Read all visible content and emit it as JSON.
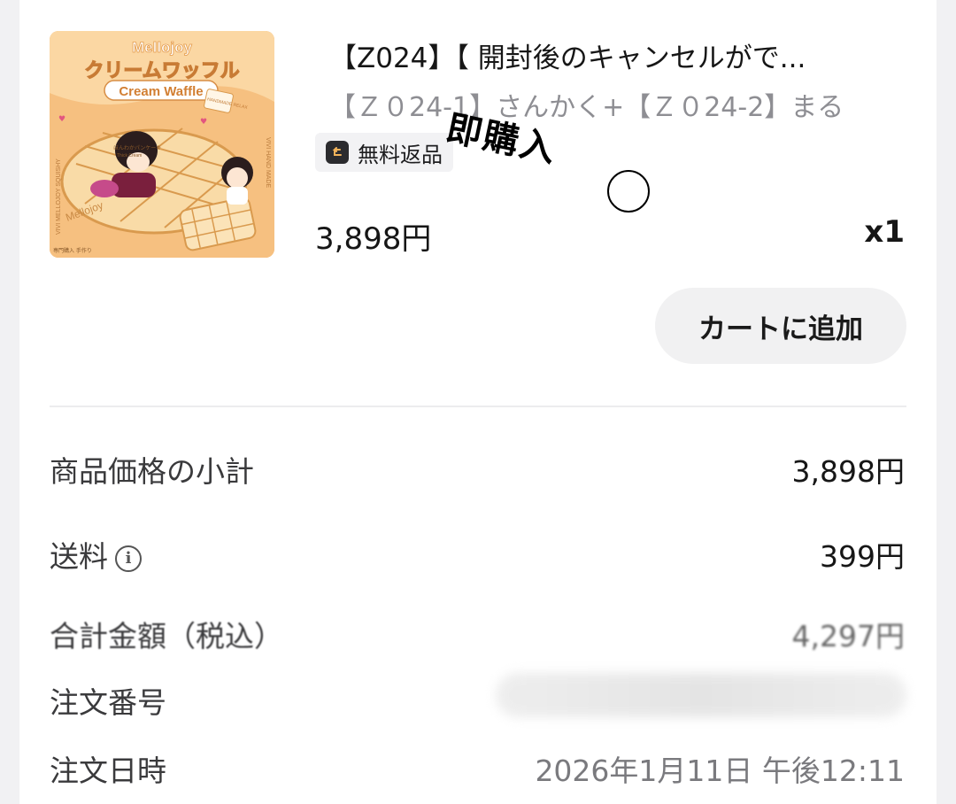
{
  "product": {
    "title": "【Z024】【 開封後のキャンセルがで...",
    "variant": "【Ｚ０24-1】さんかく+【Ｚ０24-2】まる",
    "badge": "無料返品",
    "price": "3,898円",
    "quantity": "x1",
    "add_to_cart": "カートに追加",
    "thumbnail": {
      "brand": "Mellojoy",
      "headline": "クリームワッフル",
      "subtitle": "Cream Waffle",
      "side_text_left": "VIVI MELLOJOY SQUISHY",
      "side_text_right": "VIVI HAND MADE",
      "mini_label": "ほんわかパンケーキ",
      "mini_label2": "Thick Cream",
      "card_label": "HANDMADE RELAX",
      "footer": "専門購入 手作り",
      "heart": "♥"
    }
  },
  "annotation": {
    "handwritten": "即購入",
    "circle": "○"
  },
  "summary": {
    "rows": [
      {
        "label": "商品価格の小計",
        "value": "3,898円"
      },
      {
        "label": "送料",
        "value": "399円"
      },
      {
        "label": "合計金額（税込）",
        "value": "4,297円"
      },
      {
        "label": "注文番号",
        "value": ""
      },
      {
        "label": "注文日時",
        "value": "2026年1月11日 午後12:11"
      }
    ]
  },
  "colors": {
    "accent_waffle": "#f4b870",
    "waffle_dark": "#d99a4e",
    "cream": "#fff6e6"
  },
  "icons": {
    "return": "return-icon",
    "info": "info-icon"
  }
}
